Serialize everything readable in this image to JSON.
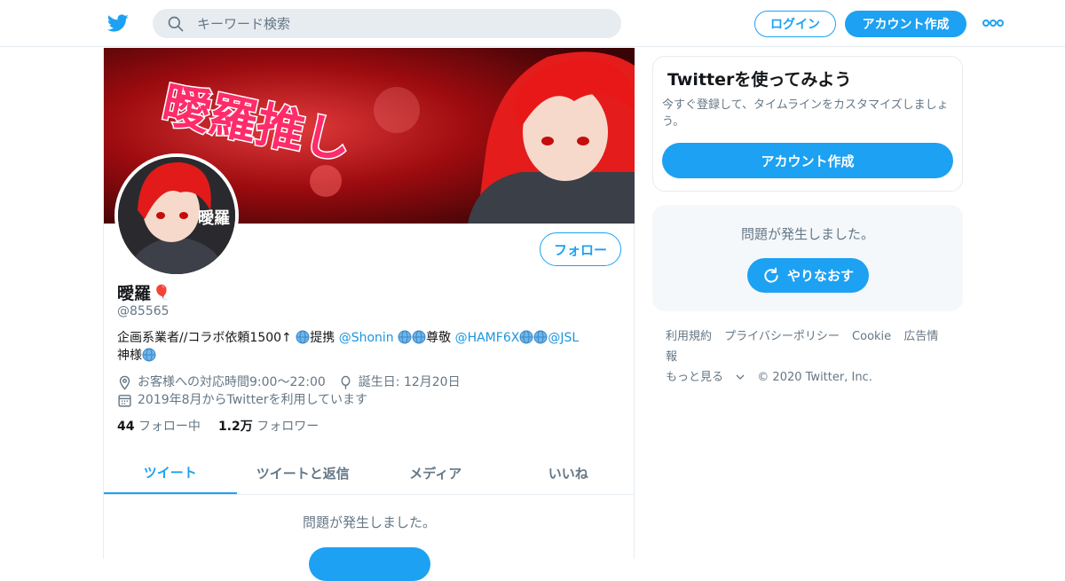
{
  "header": {
    "logo_icon": "twitter-bird-icon",
    "search_placeholder": "キーワード検索",
    "login_label": "ログイン",
    "signup_label": "アカウント作成",
    "more_icon": "more-dots-icon",
    "accent_color": "#1da1f2"
  },
  "banner": {
    "text": "曖羅推し"
  },
  "profile": {
    "avatar_text": "曖羅",
    "follow_label": "フォロー",
    "name": "曖羅",
    "name_emoji": "🎈",
    "handle": "@85565",
    "bio": {
      "t1": "企画系業者//コラボ依頼1500↑ ",
      "t2": "提携 ",
      "link1": "@Shonin",
      "t3": "尊敬 ",
      "link2": "@HAMF6X",
      "link3": "@JSL",
      "t4": "神様"
    },
    "location": "お客様への対応時間9:00～22:00",
    "birthday": "誕生日: 12月20日",
    "joined": "2019年8月からTwitterを利用しています",
    "following_count": "44",
    "following_label": "フォロー中",
    "followers_count": "1.2万",
    "followers_label": "フォロワー"
  },
  "tabs": [
    {
      "label": "ツイート",
      "active": true
    },
    {
      "label": "ツイートと返信",
      "active": false
    },
    {
      "label": "メディア",
      "active": false
    },
    {
      "label": "いいね",
      "active": false
    }
  ],
  "main": {
    "error_text": "問題が発生しました。"
  },
  "sidebar": {
    "signup_card": {
      "title": "Twitterを使ってみよう",
      "description": "今すぐ登録して、タイムラインをカスタマイズしましょう。",
      "button_label": "アカウント作成"
    },
    "error_card": {
      "message": "問題が発生しました。",
      "retry_label": "やりなおす"
    },
    "footer": {
      "links": [
        "利用規約",
        "プライバシーポリシー",
        "Cookie",
        "広告情報",
        "もっと見る"
      ],
      "copyright": "© 2020 Twitter, Inc."
    }
  }
}
